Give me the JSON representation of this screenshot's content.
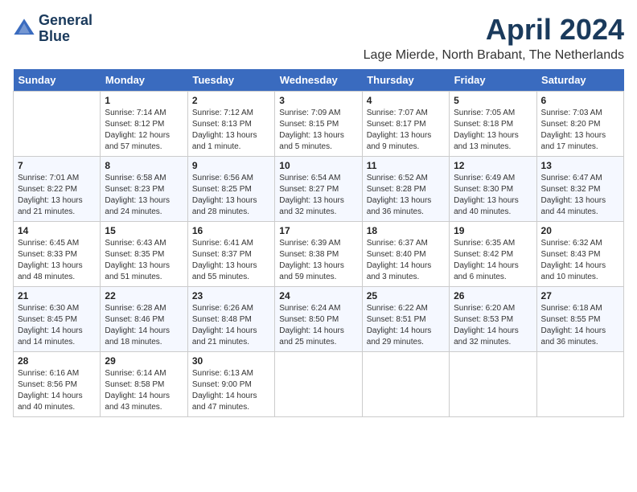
{
  "logo": {
    "line1": "General",
    "line2": "Blue"
  },
  "title": "April 2024",
  "subtitle": "Lage Mierde, North Brabant, The Netherlands",
  "weekdays": [
    "Sunday",
    "Monday",
    "Tuesday",
    "Wednesday",
    "Thursday",
    "Friday",
    "Saturday"
  ],
  "weeks": [
    [
      {
        "day": "",
        "sunrise": "",
        "sunset": "",
        "daylight": ""
      },
      {
        "day": "1",
        "sunrise": "Sunrise: 7:14 AM",
        "sunset": "Sunset: 8:12 PM",
        "daylight": "Daylight: 12 hours and 57 minutes."
      },
      {
        "day": "2",
        "sunrise": "Sunrise: 7:12 AM",
        "sunset": "Sunset: 8:13 PM",
        "daylight": "Daylight: 13 hours and 1 minute."
      },
      {
        "day": "3",
        "sunrise": "Sunrise: 7:09 AM",
        "sunset": "Sunset: 8:15 PM",
        "daylight": "Daylight: 13 hours and 5 minutes."
      },
      {
        "day": "4",
        "sunrise": "Sunrise: 7:07 AM",
        "sunset": "Sunset: 8:17 PM",
        "daylight": "Daylight: 13 hours and 9 minutes."
      },
      {
        "day": "5",
        "sunrise": "Sunrise: 7:05 AM",
        "sunset": "Sunset: 8:18 PM",
        "daylight": "Daylight: 13 hours and 13 minutes."
      },
      {
        "day": "6",
        "sunrise": "Sunrise: 7:03 AM",
        "sunset": "Sunset: 8:20 PM",
        "daylight": "Daylight: 13 hours and 17 minutes."
      }
    ],
    [
      {
        "day": "7",
        "sunrise": "Sunrise: 7:01 AM",
        "sunset": "Sunset: 8:22 PM",
        "daylight": "Daylight: 13 hours and 21 minutes."
      },
      {
        "day": "8",
        "sunrise": "Sunrise: 6:58 AM",
        "sunset": "Sunset: 8:23 PM",
        "daylight": "Daylight: 13 hours and 24 minutes."
      },
      {
        "day": "9",
        "sunrise": "Sunrise: 6:56 AM",
        "sunset": "Sunset: 8:25 PM",
        "daylight": "Daylight: 13 hours and 28 minutes."
      },
      {
        "day": "10",
        "sunrise": "Sunrise: 6:54 AM",
        "sunset": "Sunset: 8:27 PM",
        "daylight": "Daylight: 13 hours and 32 minutes."
      },
      {
        "day": "11",
        "sunrise": "Sunrise: 6:52 AM",
        "sunset": "Sunset: 8:28 PM",
        "daylight": "Daylight: 13 hours and 36 minutes."
      },
      {
        "day": "12",
        "sunrise": "Sunrise: 6:49 AM",
        "sunset": "Sunset: 8:30 PM",
        "daylight": "Daylight: 13 hours and 40 minutes."
      },
      {
        "day": "13",
        "sunrise": "Sunrise: 6:47 AM",
        "sunset": "Sunset: 8:32 PM",
        "daylight": "Daylight: 13 hours and 44 minutes."
      }
    ],
    [
      {
        "day": "14",
        "sunrise": "Sunrise: 6:45 AM",
        "sunset": "Sunset: 8:33 PM",
        "daylight": "Daylight: 13 hours and 48 minutes."
      },
      {
        "day": "15",
        "sunrise": "Sunrise: 6:43 AM",
        "sunset": "Sunset: 8:35 PM",
        "daylight": "Daylight: 13 hours and 51 minutes."
      },
      {
        "day": "16",
        "sunrise": "Sunrise: 6:41 AM",
        "sunset": "Sunset: 8:37 PM",
        "daylight": "Daylight: 13 hours and 55 minutes."
      },
      {
        "day": "17",
        "sunrise": "Sunrise: 6:39 AM",
        "sunset": "Sunset: 8:38 PM",
        "daylight": "Daylight: 13 hours and 59 minutes."
      },
      {
        "day": "18",
        "sunrise": "Sunrise: 6:37 AM",
        "sunset": "Sunset: 8:40 PM",
        "daylight": "Daylight: 14 hours and 3 minutes."
      },
      {
        "day": "19",
        "sunrise": "Sunrise: 6:35 AM",
        "sunset": "Sunset: 8:42 PM",
        "daylight": "Daylight: 14 hours and 6 minutes."
      },
      {
        "day": "20",
        "sunrise": "Sunrise: 6:32 AM",
        "sunset": "Sunset: 8:43 PM",
        "daylight": "Daylight: 14 hours and 10 minutes."
      }
    ],
    [
      {
        "day": "21",
        "sunrise": "Sunrise: 6:30 AM",
        "sunset": "Sunset: 8:45 PM",
        "daylight": "Daylight: 14 hours and 14 minutes."
      },
      {
        "day": "22",
        "sunrise": "Sunrise: 6:28 AM",
        "sunset": "Sunset: 8:46 PM",
        "daylight": "Daylight: 14 hours and 18 minutes."
      },
      {
        "day": "23",
        "sunrise": "Sunrise: 6:26 AM",
        "sunset": "Sunset: 8:48 PM",
        "daylight": "Daylight: 14 hours and 21 minutes."
      },
      {
        "day": "24",
        "sunrise": "Sunrise: 6:24 AM",
        "sunset": "Sunset: 8:50 PM",
        "daylight": "Daylight: 14 hours and 25 minutes."
      },
      {
        "day": "25",
        "sunrise": "Sunrise: 6:22 AM",
        "sunset": "Sunset: 8:51 PM",
        "daylight": "Daylight: 14 hours and 29 minutes."
      },
      {
        "day": "26",
        "sunrise": "Sunrise: 6:20 AM",
        "sunset": "Sunset: 8:53 PM",
        "daylight": "Daylight: 14 hours and 32 minutes."
      },
      {
        "day": "27",
        "sunrise": "Sunrise: 6:18 AM",
        "sunset": "Sunset: 8:55 PM",
        "daylight": "Daylight: 14 hours and 36 minutes."
      }
    ],
    [
      {
        "day": "28",
        "sunrise": "Sunrise: 6:16 AM",
        "sunset": "Sunset: 8:56 PM",
        "daylight": "Daylight: 14 hours and 40 minutes."
      },
      {
        "day": "29",
        "sunrise": "Sunrise: 6:14 AM",
        "sunset": "Sunset: 8:58 PM",
        "daylight": "Daylight: 14 hours and 43 minutes."
      },
      {
        "day": "30",
        "sunrise": "Sunrise: 6:13 AM",
        "sunset": "Sunset: 9:00 PM",
        "daylight": "Daylight: 14 hours and 47 minutes."
      },
      {
        "day": "",
        "sunrise": "",
        "sunset": "",
        "daylight": ""
      },
      {
        "day": "",
        "sunrise": "",
        "sunset": "",
        "daylight": ""
      },
      {
        "day": "",
        "sunrise": "",
        "sunset": "",
        "daylight": ""
      },
      {
        "day": "",
        "sunrise": "",
        "sunset": "",
        "daylight": ""
      }
    ]
  ]
}
